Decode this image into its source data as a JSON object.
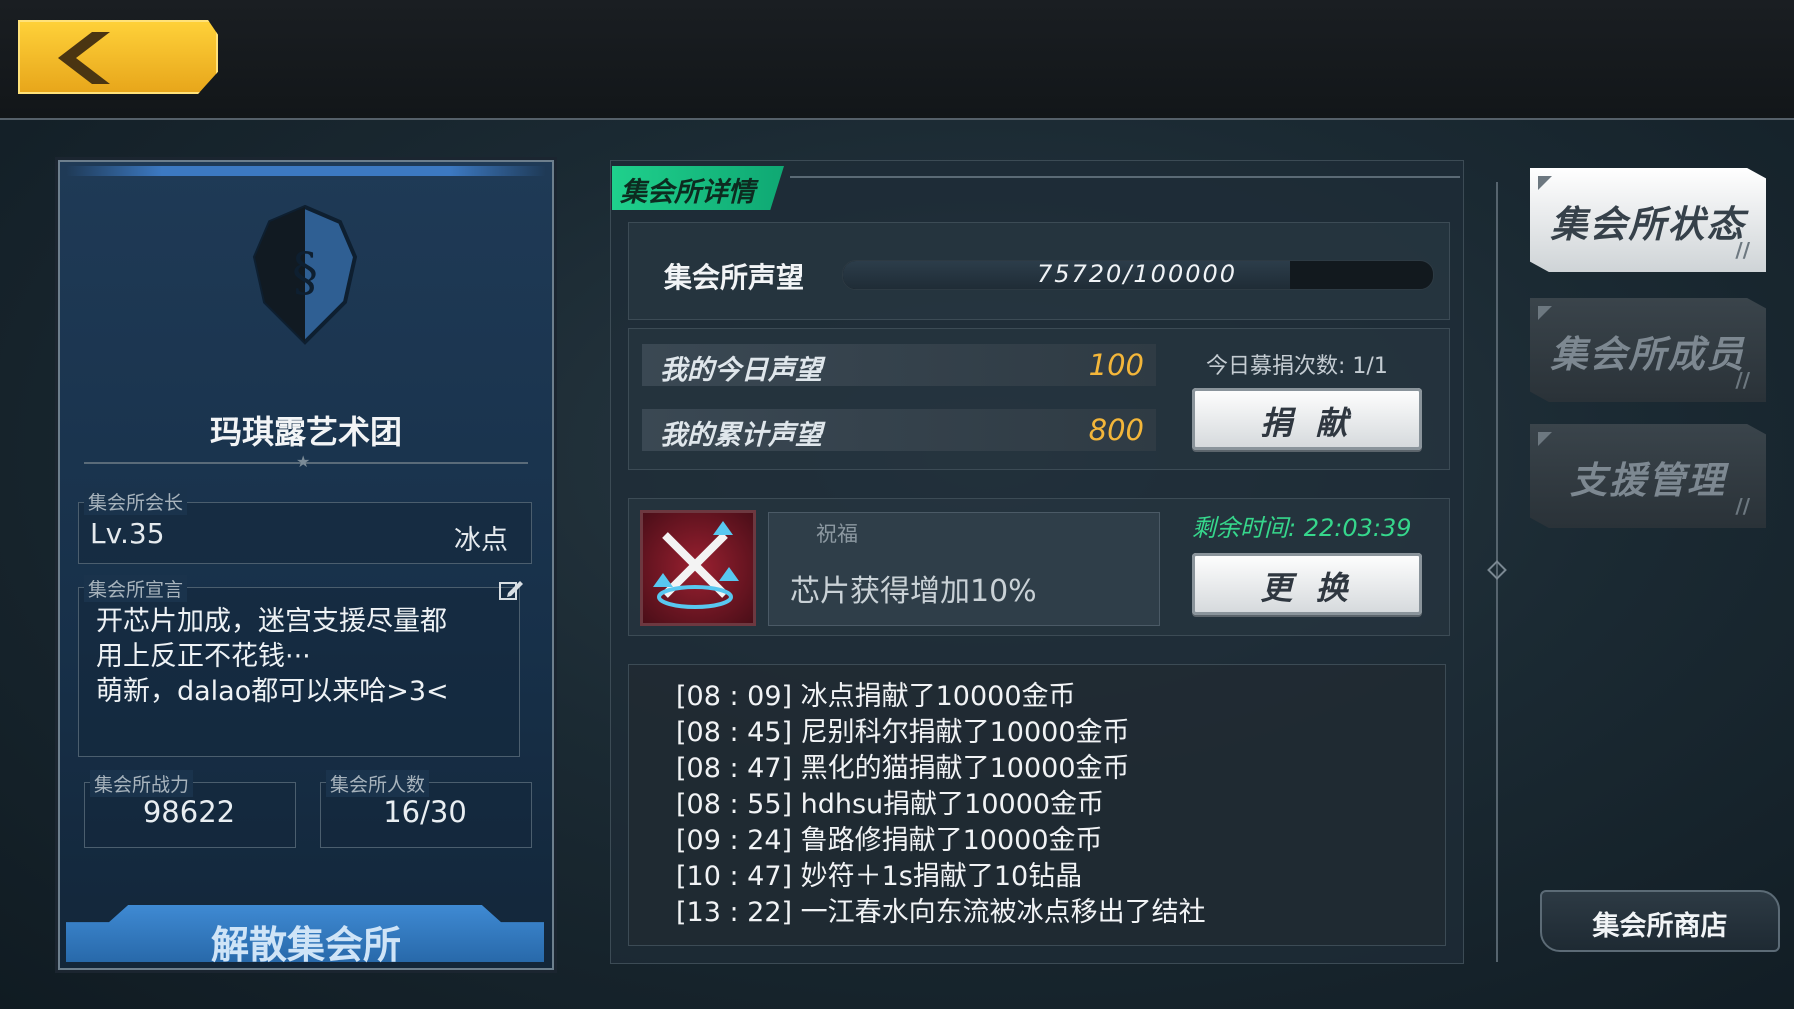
{
  "guild": {
    "name": "玛琪露艺术团",
    "leader_label": "集会所会长",
    "leader_level": "Lv.35",
    "leader_name": "冰点",
    "declaration_label": "集会所宣言",
    "declaration_lines": [
      "开芯片加成，迷宫支援尽量都",
      "用上反正不花钱···",
      "萌新，dalao都可以来哈>3<"
    ],
    "power_label": "集会所战力",
    "power_value": "98622",
    "members_label": "集会所人数",
    "members_value": "16/30",
    "disband_label": "解散集会所"
  },
  "detail": {
    "tab_label": "集会所详情",
    "reputation_label": "集会所声望",
    "reputation_text": "75720/100000",
    "reputation_fraction": 0.7572,
    "today_rep_label": "我的今日声望",
    "today_rep_value": "100",
    "total_rep_label": "我的累计声望",
    "total_rep_value": "800",
    "donate_count": "今日募捐次数: 1/1",
    "donate_button": "捐 献",
    "blessing_tag": "祝福",
    "blessing_text": "芯片获得增加10%",
    "remaining_time": "剩余时间: 22:03:39",
    "change_button": "更 换"
  },
  "log": [
    "[08 : 09] 冰点捐献了10000金币",
    "[08 : 45] 尼别科尔捐献了10000金币",
    "[08 : 47] 黑化的猫捐献了10000金币",
    "[08 : 55] hdhsu捐献了10000金币",
    "[09 : 24] 鲁路修捐献了10000金币",
    "[10 : 47] 妙符＋1s捐献了10钻晶",
    "[13 : 22] 一江春水向东流被冰点移出了结社"
  ],
  "menu": {
    "status": "集会所状态",
    "members": "集会所成员",
    "support": "支援管理",
    "shop": "集会所商店"
  },
  "colors": {
    "accent_gold": "#f3b63a",
    "timer_green": "#36d78c",
    "tab_green": "#1fd08c",
    "disband_blue": "#3f8ad3"
  },
  "icons": [
    "back-arrow-icon",
    "guild-emblem-icon",
    "edit-icon",
    "blessing-chip-icon"
  ]
}
